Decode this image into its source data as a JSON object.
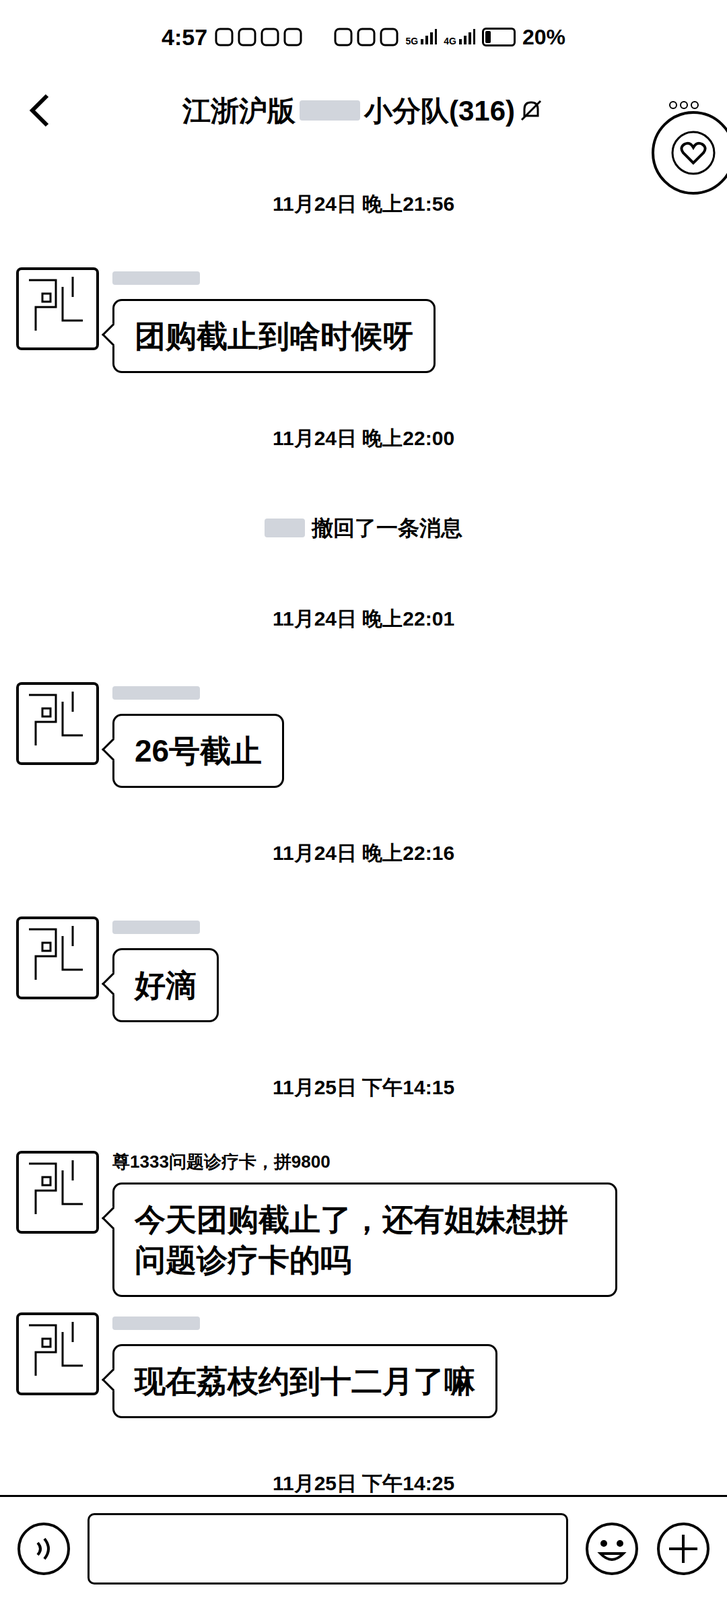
{
  "status_bar": {
    "time": "4:57",
    "network_labels": [
      "5G",
      "4G"
    ],
    "battery": "20%",
    "battery_level": 0.2
  },
  "header": {
    "title_start": "江浙沪版",
    "title_end": "小分队(316)",
    "muted": true
  },
  "messages": [
    {
      "kind": "timestamp",
      "text": "11月24日 晚上21:56"
    },
    {
      "kind": "message",
      "name": "",
      "name_redacted": true,
      "text": "团购截止到啥时候呀"
    },
    {
      "kind": "timestamp",
      "text": "11月24日 晚上22:00"
    },
    {
      "kind": "system",
      "text": "撤回了一条消息"
    },
    {
      "kind": "timestamp",
      "text": "11月24日 晚上22:01"
    },
    {
      "kind": "message",
      "name": "",
      "name_redacted": true,
      "text": "26号截止"
    },
    {
      "kind": "timestamp",
      "text": "11月24日 晚上22:16"
    },
    {
      "kind": "message",
      "name": "",
      "name_redacted": true,
      "text": "好滴"
    },
    {
      "kind": "timestamp",
      "text": "11月25日 下午14:15"
    },
    {
      "kind": "message",
      "name": "尊1333问题诊疗卡，拼9800",
      "name_redacted": false,
      "text": "今天团购截止了，还有姐妹想拼问题诊疗卡的吗"
    },
    {
      "kind": "message",
      "name": "",
      "name_redacted": true,
      "text": "现在荔枝约到十二月了嘛"
    },
    {
      "kind": "timestamp",
      "text": "11月25日 下午14:25"
    }
  ]
}
